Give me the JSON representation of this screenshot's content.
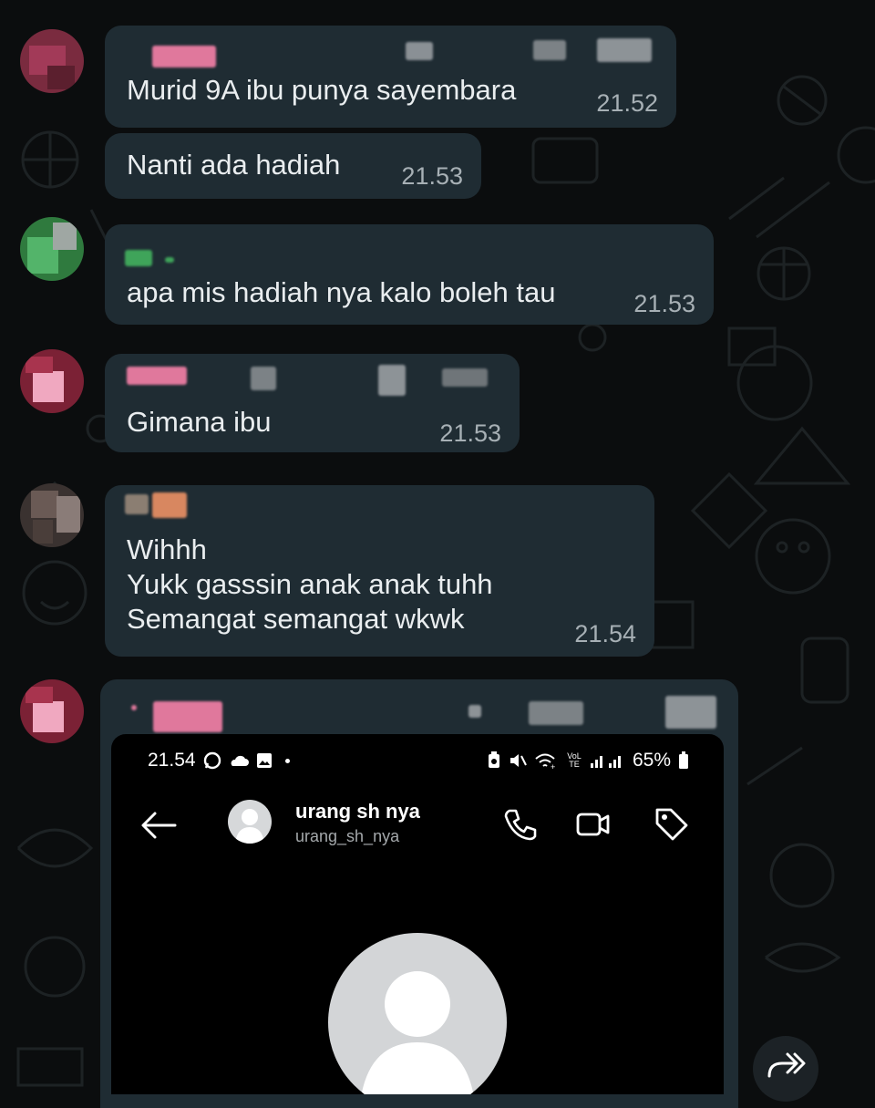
{
  "messages": [
    {
      "text": "Murid 9A ibu punya sayembara",
      "time": "21.52"
    },
    {
      "text": "Nanti ada hadiah",
      "time": "21.53"
    },
    {
      "text": "apa mis hadiah nya kalo boleh tau",
      "time": "21.53"
    },
    {
      "text": "Gimana ibu",
      "time": "21.53"
    },
    {
      "text": "Wihhh\nYukk gasssin anak anak tuhh\nSemangat semangat wkwk",
      "time": "21.54"
    }
  ],
  "screenshot": {
    "status_time": "21.54",
    "battery": "65%",
    "network_badge": "VoLTE",
    "contact_name": "urang sh nya",
    "contact_username": "urang_sh_nya"
  },
  "colors": {
    "bubble": "#1f2c33",
    "background": "#0b0d0e",
    "timestamp": "#a7b0b5"
  },
  "icons": [
    "back-arrow-icon",
    "phone-call-icon",
    "video-call-icon",
    "tag-icon",
    "forward-icon",
    "default-avatar-icon"
  ]
}
